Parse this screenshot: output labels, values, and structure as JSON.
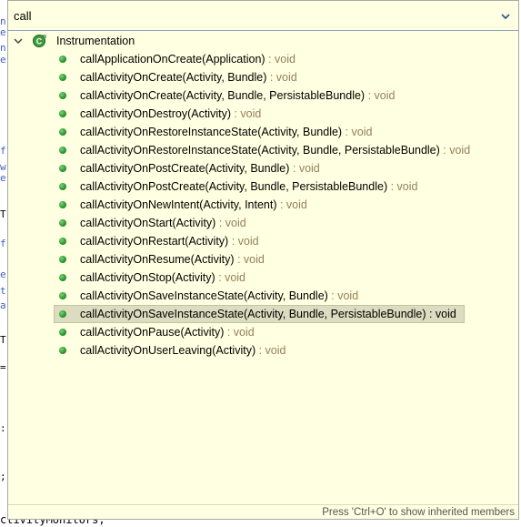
{
  "filter": {
    "value": "call",
    "dropdown_icon": "chevron-down-icon"
  },
  "tree": {
    "class_name": "Instrumentation",
    "class_icon": "class-icon",
    "methods": [
      {
        "signature": "callApplicationOnCreate(Application)",
        "returns": " : void"
      },
      {
        "signature": "callActivityOnCreate(Activity, Bundle)",
        "returns": " : void"
      },
      {
        "signature": "callActivityOnCreate(Activity, Bundle, PersistableBundle)",
        "returns": " : void"
      },
      {
        "signature": "callActivityOnDestroy(Activity)",
        "returns": " : void"
      },
      {
        "signature": "callActivityOnRestoreInstanceState(Activity, Bundle)",
        "returns": " : void"
      },
      {
        "signature": "callActivityOnRestoreInstanceState(Activity, Bundle, PersistableBundle)",
        "returns": " : void"
      },
      {
        "signature": "callActivityOnPostCreate(Activity, Bundle)",
        "returns": " : void"
      },
      {
        "signature": "callActivityOnPostCreate(Activity, Bundle, PersistableBundle)",
        "returns": " : void"
      },
      {
        "signature": "callActivityOnNewIntent(Activity, Intent)",
        "returns": " : void"
      },
      {
        "signature": "callActivityOnStart(Activity)",
        "returns": " : void"
      },
      {
        "signature": "callActivityOnRestart(Activity)",
        "returns": " : void"
      },
      {
        "signature": "callActivityOnResume(Activity)",
        "returns": " : void"
      },
      {
        "signature": "callActivityOnStop(Activity)",
        "returns": " : void"
      },
      {
        "signature": "callActivityOnSaveInstanceState(Activity, Bundle)",
        "returns": " : void"
      },
      {
        "signature": "callActivityOnSaveInstanceState(Activity, Bundle, PersistableBundle)",
        "returns": " : void",
        "selected": true
      },
      {
        "signature": "callActivityOnPause(Activity)",
        "returns": " : void"
      },
      {
        "signature": "callActivityOnUserLeaving(Activity)",
        "returns": " : void"
      }
    ]
  },
  "footer": {
    "hint": "Press 'Ctrl+O' to show inherited members"
  },
  "background_editor": {
    "bottom_line": "ctivityMonitors;"
  },
  "colors": {
    "popup_bg": "#ffffe1",
    "return_type": "#95805d",
    "selection_bg": "#dcdcc0",
    "method_dot": "#2c9a2c"
  }
}
